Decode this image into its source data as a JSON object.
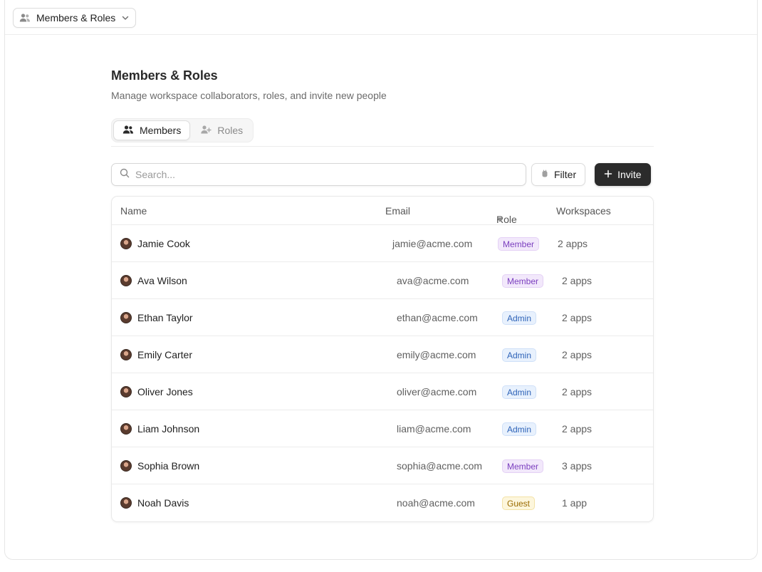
{
  "workspace_switcher": {
    "label": "Members & Roles",
    "icon": "users-icon"
  },
  "page": {
    "title": "Members & Roles",
    "subtitle": "Manage workspace collaborators, roles, and invite new people"
  },
  "tabs": [
    {
      "label": "Members",
      "icon": "users-icon",
      "active": true
    },
    {
      "label": "Roles",
      "icon": "user-plus-icon",
      "active": false
    }
  ],
  "toolbar": {
    "search_placeholder": "Search...",
    "filter_label": "Filter",
    "invite_label": "Invite"
  },
  "table": {
    "columns": {
      "name": "Name",
      "email": "Email",
      "role": "Role",
      "workspaces": "Workspaces"
    },
    "rows": [
      {
        "name": "Jamie Cook",
        "email": "jamie@acme.com",
        "role": "Member",
        "role_type": "member",
        "workspaces": "2 apps"
      },
      {
        "name": "Ava Wilson",
        "email": "ava@acme.com",
        "role": "Member",
        "role_type": "member",
        "workspaces": "2 apps"
      },
      {
        "name": "Ethan Taylor",
        "email": "ethan@acme.com",
        "role": "Admin",
        "role_type": "admin",
        "workspaces": "2 apps"
      },
      {
        "name": "Emily Carter",
        "email": "emily@acme.com",
        "role": "Admin",
        "role_type": "admin",
        "workspaces": "2 apps"
      },
      {
        "name": "Oliver Jones",
        "email": "oliver@acme.com",
        "role": "Admin",
        "role_type": "admin",
        "workspaces": "2 apps"
      },
      {
        "name": "Liam Johnson",
        "email": "liam@acme.com",
        "role": "Admin",
        "role_type": "admin",
        "workspaces": "2 apps"
      },
      {
        "name": "Sophia Brown",
        "email": "sophia@acme.com",
        "role": "Member",
        "role_type": "member",
        "workspaces": "3 apps"
      },
      {
        "name": "Noah Davis",
        "email": "noah@acme.com",
        "role": "Guest",
        "role_type": "guest",
        "workspaces": "1 app"
      }
    ]
  },
  "colors": {
    "primary_button": "#2b2b2b",
    "member_badge": "#7b3fbf",
    "admin_badge": "#2e63b8",
    "guest_badge": "#9a6b00"
  }
}
